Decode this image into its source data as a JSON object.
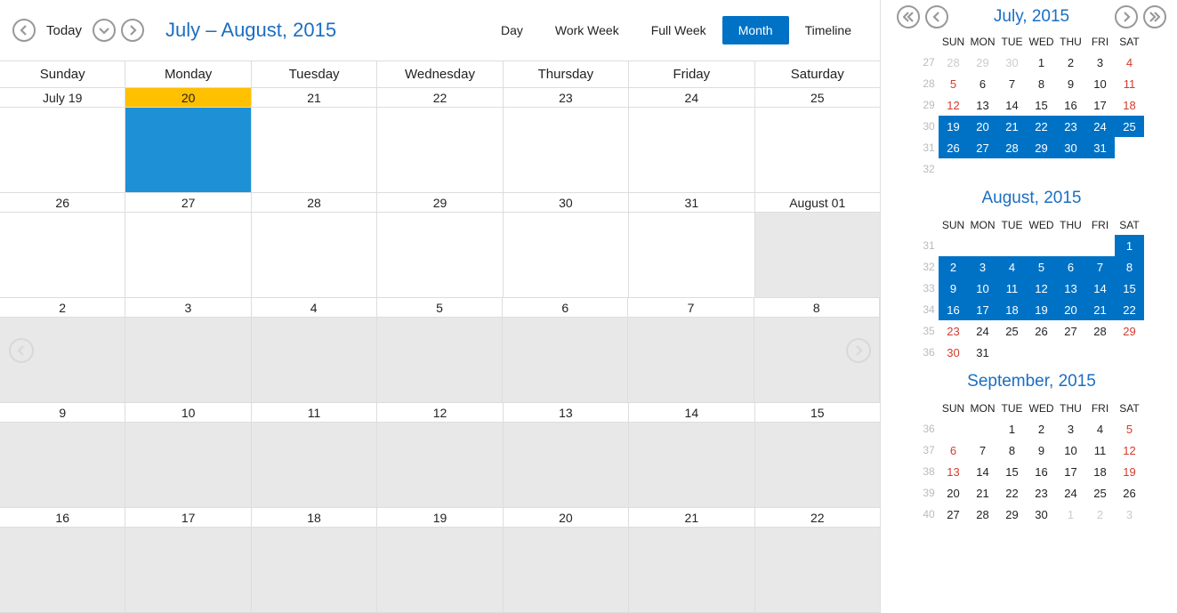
{
  "toolbar": {
    "today": "Today",
    "range": "July – August, 2015",
    "views": [
      "Day",
      "Work Week",
      "Full Week",
      "Month",
      "Timeline"
    ],
    "active_view": "Month"
  },
  "day_headers": [
    "Sunday",
    "Monday",
    "Tuesday",
    "Wednesday",
    "Thursday",
    "Friday",
    "Saturday"
  ],
  "weeks": [
    [
      {
        "l": "July 19"
      },
      {
        "l": "20",
        "today": true
      },
      {
        "l": "21"
      },
      {
        "l": "22"
      },
      {
        "l": "23"
      },
      {
        "l": "24"
      },
      {
        "l": "25"
      }
    ],
    [
      {
        "l": "26"
      },
      {
        "l": "27"
      },
      {
        "l": "28"
      },
      {
        "l": "29"
      },
      {
        "l": "30"
      },
      {
        "l": "31"
      },
      {
        "l": "August 01",
        "shade": true
      }
    ],
    [
      {
        "l": "2",
        "shade": true
      },
      {
        "l": "3",
        "shade": true
      },
      {
        "l": "4",
        "shade": true
      },
      {
        "l": "5",
        "shade": true
      },
      {
        "l": "6",
        "shade": true
      },
      {
        "l": "7",
        "shade": true
      },
      {
        "l": "8",
        "shade": true
      }
    ],
    [
      {
        "l": "9",
        "shade": true
      },
      {
        "l": "10",
        "shade": true
      },
      {
        "l": "11",
        "shade": true
      },
      {
        "l": "12",
        "shade": true
      },
      {
        "l": "13",
        "shade": true
      },
      {
        "l": "14",
        "shade": true
      },
      {
        "l": "15",
        "shade": true
      }
    ],
    [
      {
        "l": "16",
        "shade": true
      },
      {
        "l": "17",
        "shade": true
      },
      {
        "l": "18",
        "shade": true
      },
      {
        "l": "19",
        "shade": true
      },
      {
        "l": "20",
        "shade": true
      },
      {
        "l": "21",
        "shade": true
      },
      {
        "l": "22",
        "shade": true
      }
    ]
  ],
  "side_nav_title": "July, 2015",
  "mini_headers": [
    "SUN",
    "MON",
    "TUE",
    "WED",
    "THU",
    "FRI",
    "SAT"
  ],
  "minis": [
    {
      "title": "July, 2015",
      "show_title": false,
      "rows": [
        {
          "wn": "27",
          "c": [
            {
              "l": "28",
              "cls": "other"
            },
            {
              "l": "29",
              "cls": "other"
            },
            {
              "l": "30",
              "cls": "other"
            },
            {
              "l": "1"
            },
            {
              "l": "2"
            },
            {
              "l": "3"
            },
            {
              "l": "4",
              "cls": "red"
            }
          ]
        },
        {
          "wn": "28",
          "c": [
            {
              "l": "5",
              "cls": "red"
            },
            {
              "l": "6"
            },
            {
              "l": "7"
            },
            {
              "l": "8"
            },
            {
              "l": "9"
            },
            {
              "l": "10"
            },
            {
              "l": "11",
              "cls": "red"
            }
          ]
        },
        {
          "wn": "29",
          "c": [
            {
              "l": "12",
              "cls": "red"
            },
            {
              "l": "13"
            },
            {
              "l": "14"
            },
            {
              "l": "15"
            },
            {
              "l": "16"
            },
            {
              "l": "17"
            },
            {
              "l": "18",
              "cls": "red"
            }
          ]
        },
        {
          "wn": "30",
          "c": [
            {
              "l": "19",
              "cls": "sel"
            },
            {
              "l": "20",
              "cls": "sel"
            },
            {
              "l": "21",
              "cls": "sel"
            },
            {
              "l": "22",
              "cls": "sel"
            },
            {
              "l": "23",
              "cls": "sel"
            },
            {
              "l": "24",
              "cls": "sel"
            },
            {
              "l": "25",
              "cls": "sel"
            }
          ]
        },
        {
          "wn": "31",
          "c": [
            {
              "l": "26",
              "cls": "sel"
            },
            {
              "l": "27",
              "cls": "sel"
            },
            {
              "l": "28",
              "cls": "sel"
            },
            {
              "l": "29",
              "cls": "sel"
            },
            {
              "l": "30",
              "cls": "sel"
            },
            {
              "l": "31",
              "cls": "sel"
            },
            {
              "l": ""
            }
          ]
        },
        {
          "wn": "32",
          "c": [
            {
              "l": ""
            },
            {
              "l": ""
            },
            {
              "l": ""
            },
            {
              "l": ""
            },
            {
              "l": ""
            },
            {
              "l": ""
            },
            {
              "l": ""
            }
          ]
        }
      ]
    },
    {
      "title": "August, 2015",
      "show_title": true,
      "rows": [
        {
          "wn": "31",
          "c": [
            {
              "l": ""
            },
            {
              "l": ""
            },
            {
              "l": ""
            },
            {
              "l": ""
            },
            {
              "l": ""
            },
            {
              "l": ""
            },
            {
              "l": "1",
              "cls": "sel"
            }
          ]
        },
        {
          "wn": "32",
          "c": [
            {
              "l": "2",
              "cls": "sel"
            },
            {
              "l": "3",
              "cls": "sel"
            },
            {
              "l": "4",
              "cls": "sel"
            },
            {
              "l": "5",
              "cls": "sel"
            },
            {
              "l": "6",
              "cls": "sel"
            },
            {
              "l": "7",
              "cls": "sel"
            },
            {
              "l": "8",
              "cls": "sel"
            }
          ]
        },
        {
          "wn": "33",
          "c": [
            {
              "l": "9",
              "cls": "sel"
            },
            {
              "l": "10",
              "cls": "sel"
            },
            {
              "l": "11",
              "cls": "sel"
            },
            {
              "l": "12",
              "cls": "sel"
            },
            {
              "l": "13",
              "cls": "sel"
            },
            {
              "l": "14",
              "cls": "sel"
            },
            {
              "l": "15",
              "cls": "sel"
            }
          ]
        },
        {
          "wn": "34",
          "c": [
            {
              "l": "16",
              "cls": "sel"
            },
            {
              "l": "17",
              "cls": "sel"
            },
            {
              "l": "18",
              "cls": "sel"
            },
            {
              "l": "19",
              "cls": "sel"
            },
            {
              "l": "20",
              "cls": "sel"
            },
            {
              "l": "21",
              "cls": "sel"
            },
            {
              "l": "22",
              "cls": "sel"
            }
          ]
        },
        {
          "wn": "35",
          "c": [
            {
              "l": "23",
              "cls": "red"
            },
            {
              "l": "24"
            },
            {
              "l": "25"
            },
            {
              "l": "26"
            },
            {
              "l": "27"
            },
            {
              "l": "28"
            },
            {
              "l": "29",
              "cls": "red"
            }
          ]
        },
        {
          "wn": "36",
          "c": [
            {
              "l": "30",
              "cls": "red"
            },
            {
              "l": "31"
            },
            {
              "l": ""
            },
            {
              "l": ""
            },
            {
              "l": ""
            },
            {
              "l": ""
            },
            {
              "l": ""
            }
          ]
        }
      ]
    },
    {
      "title": "September, 2015",
      "show_title": true,
      "rows": [
        {
          "wn": "36",
          "c": [
            {
              "l": ""
            },
            {
              "l": ""
            },
            {
              "l": "1"
            },
            {
              "l": "2"
            },
            {
              "l": "3"
            },
            {
              "l": "4"
            },
            {
              "l": "5",
              "cls": "red"
            }
          ]
        },
        {
          "wn": "37",
          "c": [
            {
              "l": "6",
              "cls": "red"
            },
            {
              "l": "7"
            },
            {
              "l": "8"
            },
            {
              "l": "9"
            },
            {
              "l": "10"
            },
            {
              "l": "11"
            },
            {
              "l": "12",
              "cls": "red"
            }
          ]
        },
        {
          "wn": "38",
          "c": [
            {
              "l": "13",
              "cls": "red"
            },
            {
              "l": "14"
            },
            {
              "l": "15"
            },
            {
              "l": "16"
            },
            {
              "l": "17"
            },
            {
              "l": "18"
            },
            {
              "l": "19",
              "cls": "red"
            }
          ]
        },
        {
          "wn": "39",
          "c": [
            {
              "l": "20"
            },
            {
              "l": "21"
            },
            {
              "l": "22"
            },
            {
              "l": "23"
            },
            {
              "l": "24"
            },
            {
              "l": "25"
            },
            {
              "l": "26"
            }
          ]
        },
        {
          "wn": "40",
          "c": [
            {
              "l": "27"
            },
            {
              "l": "28"
            },
            {
              "l": "29"
            },
            {
              "l": "30"
            },
            {
              "l": "1",
              "cls": "other"
            },
            {
              "l": "2",
              "cls": "other"
            },
            {
              "l": "3",
              "cls": "other"
            }
          ]
        }
      ]
    }
  ]
}
